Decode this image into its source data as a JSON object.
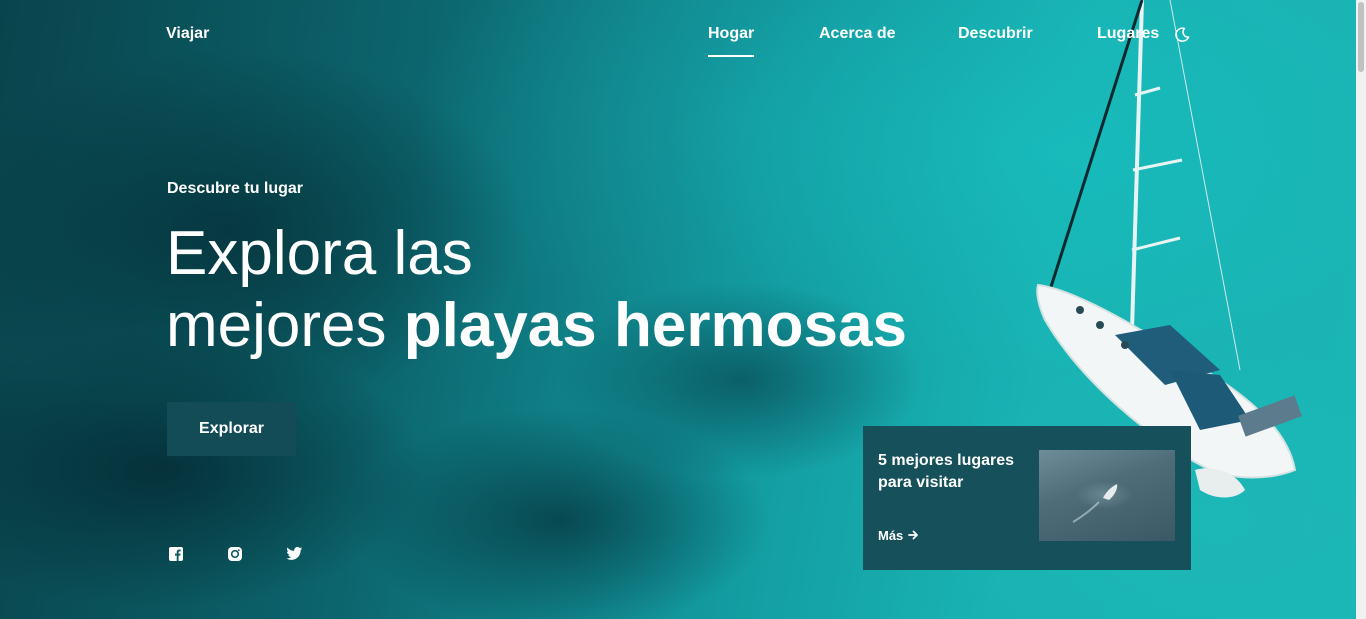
{
  "header": {
    "logo": "Viajar",
    "nav": [
      {
        "label": "Hogar",
        "active": true
      },
      {
        "label": "Acerca de",
        "active": false
      },
      {
        "label": "Descubrir",
        "active": false
      },
      {
        "label": "Lugares",
        "active": false
      }
    ],
    "theme_icon": "moon-icon"
  },
  "hero": {
    "subtitle": "Descubre tu lugar",
    "title_line1": "Explora las",
    "title_line2_regular": "mejores",
    "title_line2_bold": "playas hermosas",
    "cta_label": "Explorar"
  },
  "social": [
    "facebook-icon",
    "instagram-icon",
    "twitter-icon"
  ],
  "card": {
    "title": "5 mejores lugares para visitar",
    "more_label": "Más",
    "more_icon": "arrow-right-icon"
  },
  "colors": {
    "button_bg": "#134b57",
    "card_bg": "#16505b",
    "text": "#ffffff"
  }
}
